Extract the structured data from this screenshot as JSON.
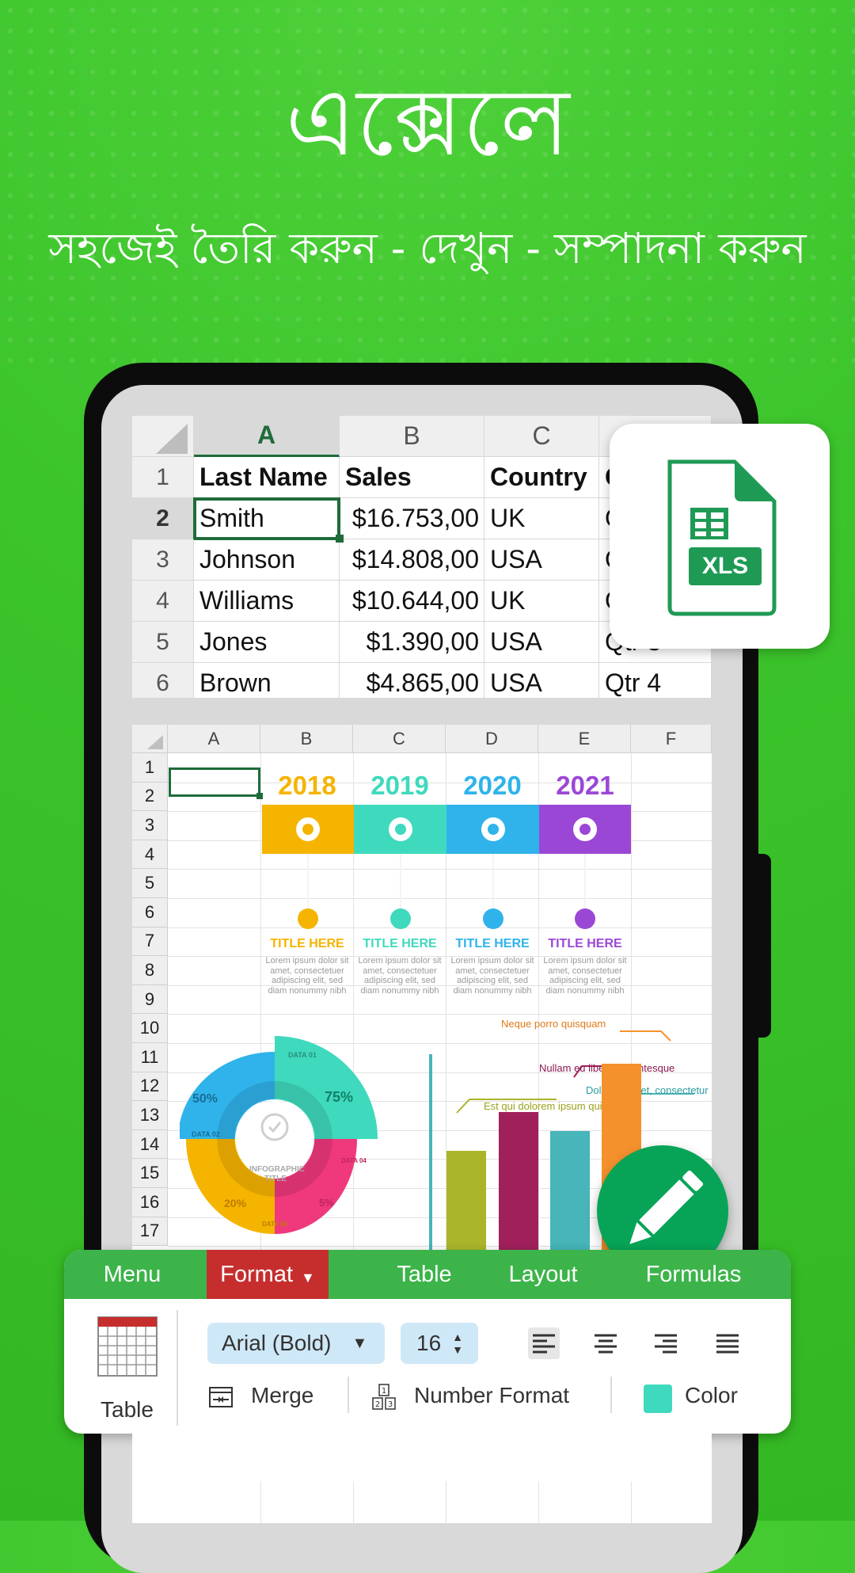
{
  "hero": {
    "title": "এক্সেলে",
    "subtitle": "সহজেই তৈরি করুন - দেখুন - সম্পাদনা করুন"
  },
  "sheet1": {
    "columns": [
      "A",
      "B",
      "C"
    ],
    "rows": [
      {
        "num": "1",
        "a": "Last Name",
        "b": "Sales",
        "c": "Country",
        "d": "Q"
      },
      {
        "num": "2",
        "a": "Smith",
        "b": "$16.753,00",
        "c": "UK",
        "d": "Q"
      },
      {
        "num": "3",
        "a": "Johnson",
        "b": "$14.808,00",
        "c": "USA",
        "d": "Q"
      },
      {
        "num": "4",
        "a": "Williams",
        "b": "$10.644,00",
        "c": "UK",
        "d": "Q"
      },
      {
        "num": "5",
        "a": "Jones",
        "b": "$1.390,00",
        "c": "USA",
        "d": "Qtr 3"
      },
      {
        "num": "6",
        "a": "Brown",
        "b": "$4.865,00",
        "c": "USA",
        "d": "Qtr 4"
      }
    ]
  },
  "xls_badge": {
    "label": "XLS",
    "color": "#1f9a55"
  },
  "sheet2": {
    "columns": [
      "A",
      "B",
      "C",
      "D",
      "E",
      "F"
    ],
    "row_numbers": [
      "1",
      "2",
      "3",
      "4",
      "5",
      "6",
      "7",
      "8",
      "9",
      "10",
      "11",
      "12",
      "13",
      "14",
      "15",
      "16",
      "17"
    ],
    "timeline": [
      {
        "year": "2018",
        "title": "TITLE HERE",
        "color": "#f5b400"
      },
      {
        "year": "2019",
        "title": "TITLE HERE",
        "color": "#3fd9bd"
      },
      {
        "year": "2020",
        "title": "TITLE HERE",
        "color": "#2fb3ea"
      },
      {
        "year": "2021",
        "title": "TITLE HERE",
        "color": "#9b47d6"
      }
    ],
    "lorem": "Lorem ipsum dolor sit amet, consectetuer adipiscing elit, sed diam nonummy nibh euismod tincidunt diam sed",
    "donut": {
      "center_title": "INFOGRAPHIC TITLE",
      "segments": [
        {
          "label": "DATA 01",
          "pct": "75%",
          "color": "#3fd9bd"
        },
        {
          "label": "DATA 02",
          "pct": "50%",
          "color": "#2fb3ea"
        },
        {
          "label": "DATA 03",
          "pct": "20%",
          "color": "#f5b400"
        },
        {
          "label": "DATA 04",
          "pct": "5%",
          "color": "#f0387d"
        }
      ]
    },
    "bars": {
      "notes": [
        "Neque porro quisquam",
        "Nullam eu libero pellentesque",
        "Dolor sit amet, consectetur",
        "Est qui dolorem ipsum quia"
      ],
      "colors": [
        "#aab52a",
        "#a0205c",
        "#47b5b9",
        "#f5912d"
      ],
      "values": [
        0.55,
        0.75,
        0.65,
        1.0
      ]
    }
  },
  "toolbar": {
    "tabs": [
      "Menu",
      "Format",
      "Table",
      "Layout",
      "Formulas"
    ],
    "active_tab": "Format",
    "table_label": "Table",
    "font_name": "Arial (Bold)",
    "font_size": "16",
    "merge_label": "Merge",
    "number_format_label": "Number Format",
    "color_label": "Color",
    "color_swatch": "#3fd9bd"
  },
  "colors": {
    "background": "#3cc42b",
    "tab_bar": "#3cb44a",
    "tab_active": "#c62e2e",
    "fab": "#07a457"
  }
}
